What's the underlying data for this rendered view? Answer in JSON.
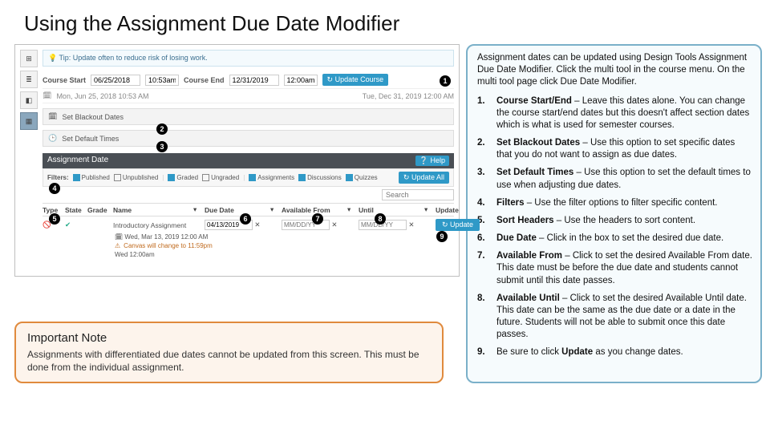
{
  "page_title": "Using the Assignment Due Date Modifier",
  "screenshot": {
    "tip": "Tip: Update often to reduce risk of losing work.",
    "course_start_label": "Course Start",
    "course_start_date": "06/25/2018",
    "course_start_time": "10:53am",
    "course_end_label": "Course End",
    "course_end_date": "12/31/2019",
    "course_end_time": "12:00am",
    "update_course_btn": "↻ Update Course",
    "start_long": "Mon, Jun 25, 2018 10:53 AM",
    "end_long": "Tue, Dec 31, 2019 12:00 AM",
    "blackout_label": "Set Blackout Dates",
    "default_times_label": "Set Default Times",
    "assignment_date_header": "Assignment Date",
    "help_label": "Help",
    "filters_label": "Filters:",
    "filter_published": "Published",
    "filter_unpublished": "Unpublished",
    "filter_graded": "Graded",
    "filter_ungraded": "Ungraded",
    "filter_assignments": "Assignments",
    "filter_discussions": "Discussions",
    "filter_quizzes": "Quizzes",
    "update_all_btn": "↻ Update All",
    "search_placeholder": "Search",
    "col_type": "Type",
    "col_state": "State",
    "col_grade": "Grade",
    "col_name": "Name",
    "col_due": "Due Date",
    "col_from": "Available From",
    "col_until": "Until",
    "col_update": "Update",
    "row_name": "Introductory Assignment",
    "row_due": "04/13/2019",
    "row_ph": "MM/DD/YY",
    "row_update_btn": "↻ Update",
    "sub_date": "Wed, Mar 13, 2019 12:00 AM",
    "canvas_note": "Canvas will change to 11:59pm",
    "canvas_note2": "Wed 12:00am"
  },
  "note": {
    "title": "Important Note",
    "body": "Assignments with differentiated due dates cannot be updated from this screen. This must be done from the individual assignment."
  },
  "right": {
    "intro": "Assignment dates can be updated using Design Tools Assignment Due Date Modifier. Click the multi tool in the course menu. On the multi tool page click Due Date Modifier.",
    "items": [
      {
        "num": "1.",
        "bold": "Course Start/End",
        "rest": " – Leave this dates alone. You can change the course start/end dates but this doesn't affect section dates which is what is used for semester courses."
      },
      {
        "num": "2.",
        "bold": "Set Blackout Dates",
        "rest": " – Use this option to set specific dates that you do not want to assign as due dates."
      },
      {
        "num": "3.",
        "bold": "Set Default Times",
        "rest": " – Use this option to set the default times to use when adjusting due dates."
      },
      {
        "num": "4.",
        "bold": "Filters",
        "rest": " – Use the filter options to filter specific content."
      },
      {
        "num": "5.",
        "bold": "Sort Headers",
        "rest": " – Use the headers to sort content."
      },
      {
        "num": "6.",
        "bold": "Due Date",
        "rest": " – Click in the box to set the desired due date."
      },
      {
        "num": "7.",
        "bold": "Available From",
        "rest": " – Click to set the desired Available From date. This date must be before the due date and students cannot submit until this date passes."
      },
      {
        "num": "8.",
        "bold": "Available Until",
        "rest": " – Click to set the desired Available Until date. This date can be the same as the due date or a date in the future. Students will not be able to submit once this date passes."
      },
      {
        "num": "9.",
        "bold": "",
        "rest": "Be sure to click ",
        "bold2": "Update",
        "rest2": " as you change dates."
      }
    ]
  }
}
